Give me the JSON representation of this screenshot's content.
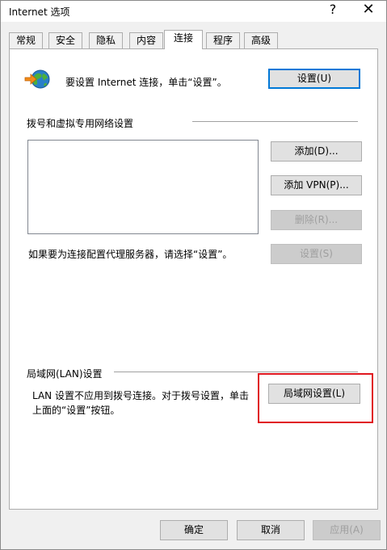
{
  "window": {
    "title": "Internet 选项",
    "help_label": "?",
    "close_label": "✕"
  },
  "tabs": [
    {
      "label": "常规"
    },
    {
      "label": "安全"
    },
    {
      "label": "隐私"
    },
    {
      "label": "内容"
    },
    {
      "label": "连接"
    },
    {
      "label": "程序"
    },
    {
      "label": "高级"
    }
  ],
  "setup": {
    "text": "要设置 Internet 连接，单击“设置”。",
    "button": "设置(U)"
  },
  "dialup": {
    "heading": "拨号和虚拟专用网络设置",
    "add_button": "添加(D)...",
    "add_vpn_button": "添加 VPN(P)...",
    "remove_button": "删除(R)...",
    "settings_button": "设置(S)",
    "proxy_text": "如果要为连接配置代理服务器，请选择“设置”。"
  },
  "lan": {
    "heading": "局域网(LAN)设置",
    "text_line1": "LAN 设置不应用到拨号连接。对于拨号设置，单击",
    "text_line2": "上面的“设置”按钮。",
    "button": "局域网设置(L)"
  },
  "footer": {
    "ok": "确定",
    "cancel": "取消",
    "apply": "应用(A)"
  },
  "colors": {
    "highlight": "#e0161f",
    "default_button_border": "#0078d7"
  }
}
